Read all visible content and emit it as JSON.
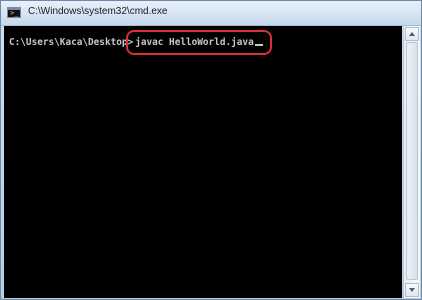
{
  "window": {
    "title": "C:\\Windows\\system32\\cmd.exe",
    "icon": "command-prompt-icon",
    "icon_glyph": ">_"
  },
  "console": {
    "prompt": "C:\\Users\\Kaca\\Desktop>",
    "command": "javac HelloWorld.java",
    "highlight_color": "#d9303a",
    "text_color": "#c8c8c8",
    "background_color": "#000000"
  }
}
